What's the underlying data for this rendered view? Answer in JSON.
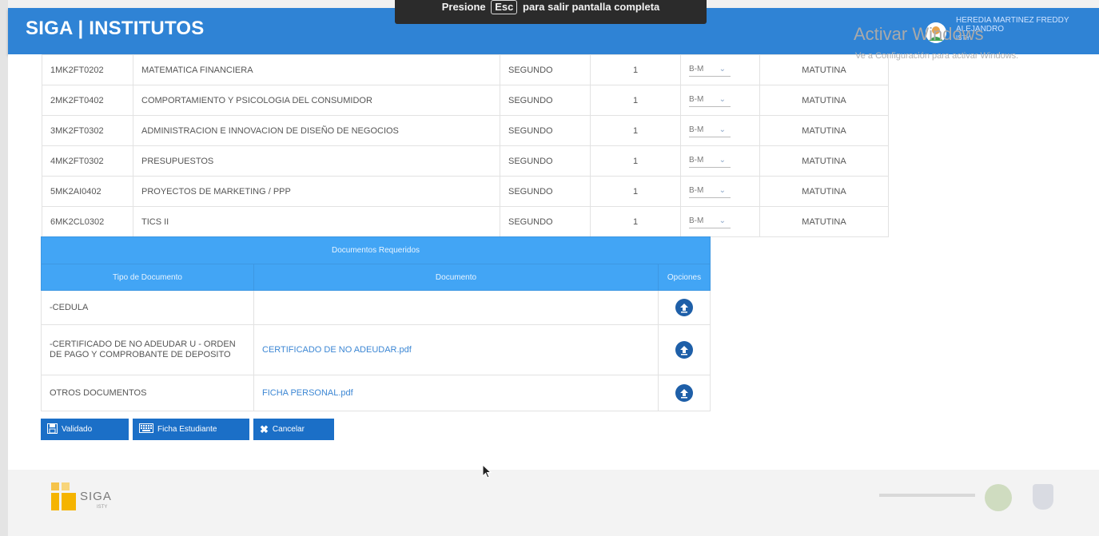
{
  "header": {
    "title": "SIGA | INSTITUTOS",
    "user_name": "HEREDIA MARTINEZ FREDDY ALEJANDRO",
    "user_institute": "ISTY",
    "accent_color": "#2f83d5"
  },
  "toast": {
    "before": "Presione",
    "key": "Esc",
    "after": "para salir pantalla completa"
  },
  "subjects": [
    {
      "code": "1MK2FT0202",
      "name": "MATEMATICA FINANCIERA",
      "level": "SEGUNDO",
      "number": "1",
      "parallel": "B-M",
      "schedule": "MATUTINA"
    },
    {
      "code": "2MK2FT0402",
      "name": "COMPORTAMIENTO Y PSICOLOGIA DEL CONSUMIDOR",
      "level": "SEGUNDO",
      "number": "1",
      "parallel": "B-M",
      "schedule": "MATUTINA"
    },
    {
      "code": "3MK2FT0302",
      "name": "ADMINISTRACION E INNOVACION DE DISEÑO DE NEGOCIOS",
      "level": "SEGUNDO",
      "number": "1",
      "parallel": "B-M",
      "schedule": "MATUTINA"
    },
    {
      "code": "4MK2FT0302",
      "name": "PRESUPUESTOS",
      "level": "SEGUNDO",
      "number": "1",
      "parallel": "B-M",
      "schedule": "MATUTINA"
    },
    {
      "code": "5MK2AI0402",
      "name": "PROYECTOS DE MARKETING / PPP",
      "level": "SEGUNDO",
      "number": "1",
      "parallel": "B-M",
      "schedule": "MATUTINA"
    },
    {
      "code": "6MK2CL0302",
      "name": "TICS II",
      "level": "SEGUNDO",
      "number": "1",
      "parallel": "B-M",
      "schedule": "MATUTINA"
    }
  ],
  "documents": {
    "title": "Documentos Requeridos",
    "col_type": "Tipo de Documento",
    "col_document": "Documento",
    "col_options": "Opciones",
    "rows": [
      {
        "type": "-CEDULA",
        "document": ""
      },
      {
        "type": "-CERTIFICADO DE NO ADEUDAR U - ORDEN DE PAGO Y COMPROBANTE DE DEPOSITO",
        "document": "CERTIFICADO DE NO ADEUDAR.pdf"
      },
      {
        "type": "OTROS DOCUMENTOS",
        "document": "FICHA PERSONAL.pdf"
      }
    ]
  },
  "buttons": {
    "validated": "Validado",
    "student_card": "Ficha Estudiante",
    "cancel": "Cancelar"
  },
  "footer": {
    "logo_text": "SIGA",
    "logo_sub": "ISTY",
    "activate_title": "Activar Windows",
    "activate_sub": "Ve a Configuración para activar Windows."
  }
}
